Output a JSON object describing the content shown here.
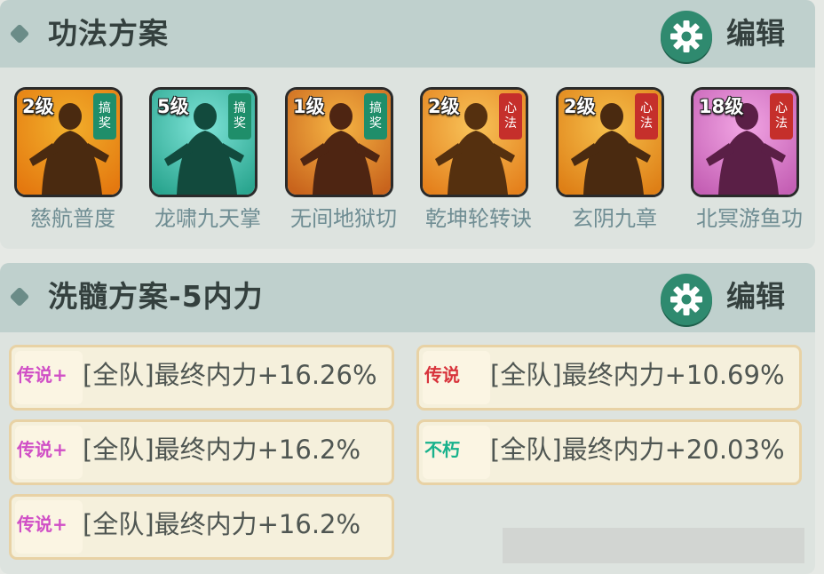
{
  "plan": {
    "title": "功法方案",
    "edit_label": "编辑",
    "skills": [
      {
        "level": "2级",
        "tag": "搞奖",
        "tag_color": "green",
        "name": "慈航普度",
        "bg": [
          "#f2b02c",
          "#e4780f"
        ],
        "sil": "#4a2a10"
      },
      {
        "level": "5级",
        "tag": "搞奖",
        "tag_color": "green",
        "name": "龙啸九天掌",
        "bg": [
          "#7fe4d8",
          "#2aa58f"
        ],
        "sil": "#124a3d"
      },
      {
        "level": "1级",
        "tag": "搞奖",
        "tag_color": "green",
        "name": "无间地狱切",
        "bg": [
          "#f6b544",
          "#c8631c"
        ],
        "sil": "#4e2512"
      },
      {
        "level": "2级",
        "tag": "心法",
        "tag_color": "red",
        "name": "乾坤轮转诀",
        "bg": [
          "#f8c45a",
          "#e4801c"
        ],
        "sil": "#55300f"
      },
      {
        "level": "2级",
        "tag": "心法",
        "tag_color": "red",
        "name": "玄阴九章",
        "bg": [
          "#f6c04c",
          "#de7f16"
        ],
        "sil": "#4a2a10"
      },
      {
        "level": "18级",
        "tag": "心法",
        "tag_color": "red",
        "name": "北冥游鱼功",
        "bg": [
          "#f2a6e4",
          "#c45fb4"
        ],
        "sil": "#5a1f46"
      }
    ]
  },
  "refine": {
    "title": "洗髓方案-5内力",
    "edit_label": "编辑",
    "attributes": [
      {
        "quality": "传说+",
        "quality_color": "purple",
        "text": "[全队]最终内力+16.26%"
      },
      {
        "quality": "传说",
        "quality_color": "red",
        "text": "[全队]最终内力+10.69%"
      },
      {
        "quality": "传说+",
        "quality_color": "purple",
        "text": "[全队]最终内力+16.2%"
      },
      {
        "quality": "不朽",
        "quality_color": "teal",
        "text": "[全队]最终内力+20.03%"
      },
      {
        "quality": "传说+",
        "quality_color": "purple",
        "text": "[全队]最终内力+16.2%"
      }
    ]
  }
}
